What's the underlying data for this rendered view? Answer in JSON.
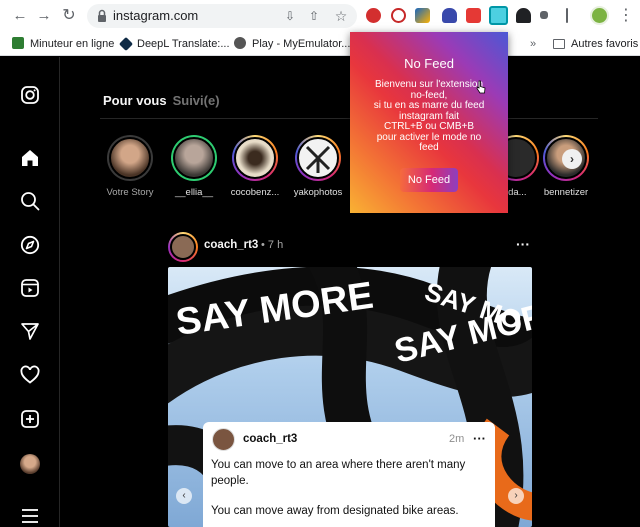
{
  "browser": {
    "url": "instagram.com",
    "bookmarks": [
      {
        "label": "Minuteur en ligne",
        "icon": "bookmark-timer-icon",
        "color": "#2e7d32"
      },
      {
        "label": "DeepL Translate:...",
        "icon": "deepl-icon",
        "color": "#0f2b46"
      },
      {
        "label": "Play - MyEmulator...",
        "icon": "play-emulator-icon",
        "color": "#555555"
      }
    ],
    "folder_label": "Autres favoris"
  },
  "instagram": {
    "tabs": {
      "active": "Pour vous",
      "inactive": "Suivi(e)"
    },
    "stories": [
      {
        "name": "Votre Story",
        "ring": "seen",
        "color": "#6b4a3a"
      },
      {
        "name": "__ellia__",
        "ring": "green",
        "color": "#9a8478"
      },
      {
        "name": "cocobenz...",
        "ring": "new",
        "color": "#c9b79a"
      },
      {
        "name": "yakophotos",
        "ring": "new",
        "color": "#8a8a8a"
      }
    ],
    "stories_partial": [
      ".da...",
      "bennetizer"
    ],
    "post": {
      "user": "coach_rt3",
      "time": "• 7 h",
      "card": {
        "user": "coach_rt3",
        "time": "2m",
        "lines": [
          "You can move to an area where there aren't many people.",
          "You can move away from designated bike areas."
        ]
      },
      "media_text": [
        "SAY MORE",
        "SAY MORE",
        "SAY MO"
      ]
    }
  },
  "popup": {
    "title": "No Feed",
    "body": [
      "Bienvenu sur l'extension",
      "no-feed,",
      "si tu en as marre du feed",
      "instagram fait",
      "CTRL+B ou CMB+B",
      "pour activer le mode no",
      "feed"
    ],
    "button": "No Feed"
  }
}
